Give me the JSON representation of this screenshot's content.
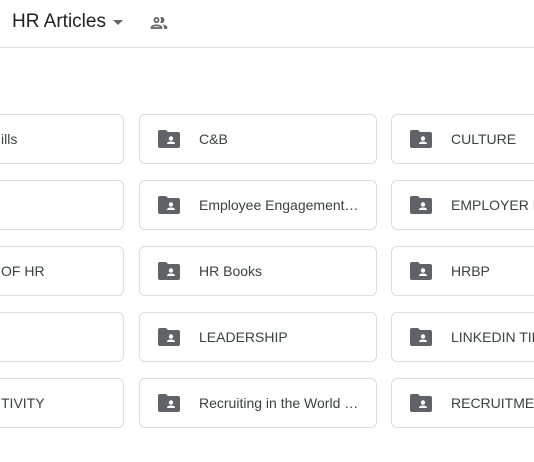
{
  "header": {
    "title": "HR Articles"
  },
  "folders": {
    "col1": [
      "ills",
      "",
      "OF HR",
      "",
      "TIVITY"
    ],
    "col2": [
      "C&B",
      "Employee Engagement and Retention",
      "HR Books",
      "LEADERSHIP",
      "Recruiting in the World Of Work"
    ],
    "col3": [
      "CULTURE",
      "EMPLOYER BRANDING",
      "HRBP",
      "LINKEDIN TIPS",
      "RECRUITMENT"
    ]
  },
  "colors": {
    "folder_icon": "#5f6368",
    "border": "#dadce0",
    "text": "#3c4043"
  }
}
